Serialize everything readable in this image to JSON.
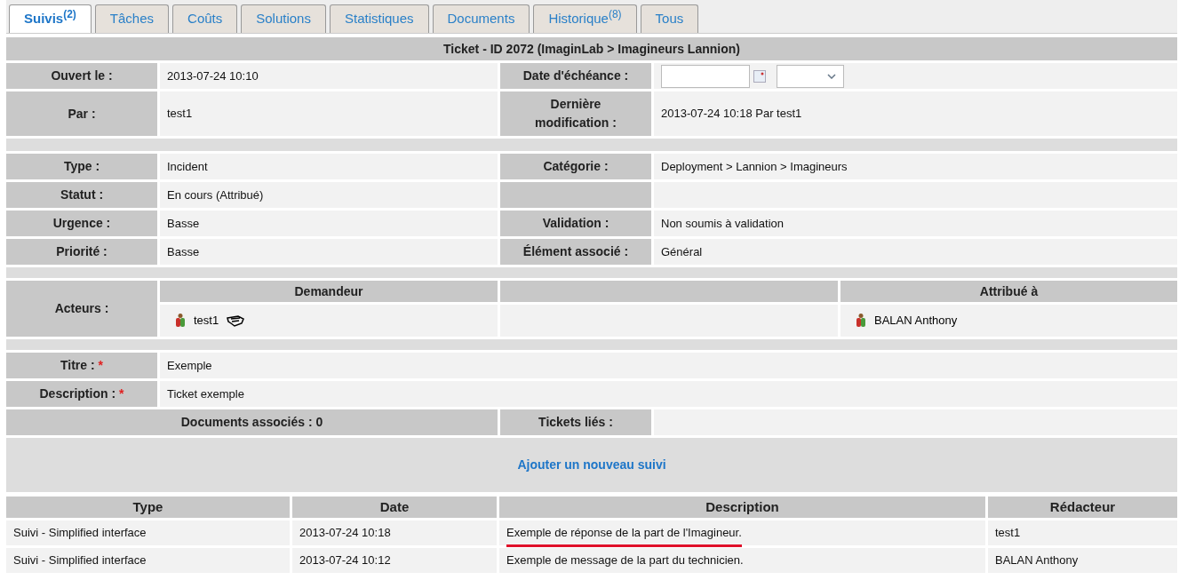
{
  "tabs": [
    {
      "label": "Suivis",
      "count": "(2)",
      "selected": true
    },
    {
      "label": "Tâches",
      "selected": false
    },
    {
      "label": "Coûts",
      "selected": false
    },
    {
      "label": "Solutions",
      "selected": false
    },
    {
      "label": "Statistiques",
      "selected": false
    },
    {
      "label": "Documents",
      "selected": false
    },
    {
      "label": "Historique",
      "count": "(8)",
      "selected": false
    },
    {
      "label": "Tous",
      "selected": false
    }
  ],
  "header": "Ticket - ID 2072 (ImaginLab > Imagineurs Lannion)",
  "info_groups": [
    [
      {
        "left": {
          "label": "Ouvert le :",
          "value": "2013-07-24 10:10"
        },
        "right": {
          "label": "Date d'échéance :",
          "kind": "date"
        }
      },
      {
        "left": {
          "label": "Par :",
          "value": "test1"
        },
        "right": {
          "label": "Dernière modification :",
          "value": "2013-07-24 10:18 Par test1",
          "kind": "text"
        }
      }
    ],
    [
      {
        "left": {
          "label": "Type :",
          "value": "Incident"
        },
        "right": {
          "label": "Catégorie :",
          "value": "Deployment > Lannion > Imagineurs",
          "kind": "text"
        }
      },
      {
        "left": {
          "label": "Statut :",
          "value": "En cours (Attribué)"
        },
        "right": {
          "kind": "empty"
        }
      },
      {
        "left": {
          "label": "Urgence :",
          "value": "Basse"
        },
        "right": {
          "label": "Validation :",
          "value": "Non soumis à validation",
          "kind": "text"
        }
      },
      {
        "left": {
          "label": "Priorité :",
          "value": "Basse"
        },
        "right": {
          "label": "Élément associé :",
          "value": "Général",
          "kind": "text"
        }
      }
    ]
  ],
  "actors": {
    "label": "Acteurs :",
    "columns": [
      {
        "heading": "Demandeur",
        "people": [
          {
            "name": "test1",
            "editable": true
          }
        ]
      },
      {},
      {
        "heading": "Attribué à",
        "people": [
          {
            "name": "BALAN Anthony",
            "editable": false
          }
        ]
      }
    ]
  },
  "details": [
    {
      "label": "Titre :",
      "required_mark": "*",
      "value": "Exemple"
    },
    {
      "label": "Description :",
      "required_mark": "*",
      "value": "Ticket exemple"
    }
  ],
  "links_row": {
    "documents": "Documents associés : 0",
    "tickets": "Tickets liés :"
  },
  "add_link": "Ajouter un nouveau suivi",
  "followups": {
    "columns": [
      "Type",
      "Date",
      "Description",
      "Rédacteur"
    ],
    "rows": [
      {
        "cells": [
          "Suivi - Simplified interface",
          "2013-07-24 10:18",
          "Exemple de réponse de la part de l'Imagineur.",
          "test1"
        ],
        "underlined": true
      },
      {
        "cells": [
          "Suivi - Simplified interface",
          "2013-07-24 10:12",
          "Exemple de message de la part du technicien.",
          "BALAN Anthony"
        ],
        "underlined": false
      }
    ]
  }
}
